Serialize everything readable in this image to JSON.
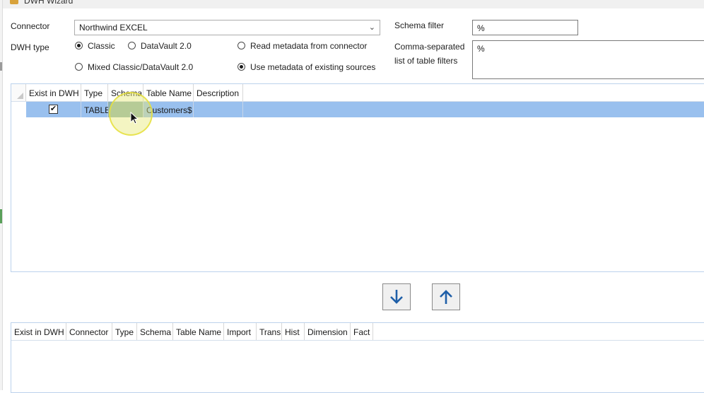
{
  "window": {
    "title": "DWH Wizard"
  },
  "form": {
    "connector_label": "Connector",
    "connector_value": "Northwind EXCEL",
    "dwh_type_label": "DWH type",
    "radio_classic": "Classic",
    "radio_datavault": "DataVault 2.0",
    "radio_mixed": "Mixed Classic/DataVault 2.0",
    "radio_read_metadata": "Read metadata from connector",
    "radio_use_metadata": "Use metadata of existing sources",
    "schema_filter_label": "Schema filter",
    "schema_filter_value": "%",
    "table_filters_label_1": "Comma-separated",
    "table_filters_label_2": "list of table filters",
    "table_filters_value": "%",
    "selected": {
      "dwh_type": "Classic",
      "metadata_source": "Use metadata of existing sources"
    }
  },
  "source_grid": {
    "columns": [
      "Exist in DWH",
      "Type",
      "Schema",
      "Table Name",
      "Description"
    ],
    "rows": [
      {
        "exist_in_dwh": true,
        "type": "TABLE",
        "schema": "",
        "table_name": "Customers$",
        "description": ""
      }
    ]
  },
  "transfer": {
    "down_icon": "arrow-down-icon",
    "up_icon": "arrow-up-icon"
  },
  "target_grid": {
    "columns": [
      "Exist in DWH",
      "Connector",
      "Type",
      "Schema",
      "Table Name",
      "Import",
      "Trans",
      "Hist",
      "Dimension",
      "Fact"
    ],
    "rows": []
  },
  "colors": {
    "selection": "#99c0ee",
    "accent_arrow": "#1f5fa8",
    "cursor_highlight": "#e6e178"
  }
}
